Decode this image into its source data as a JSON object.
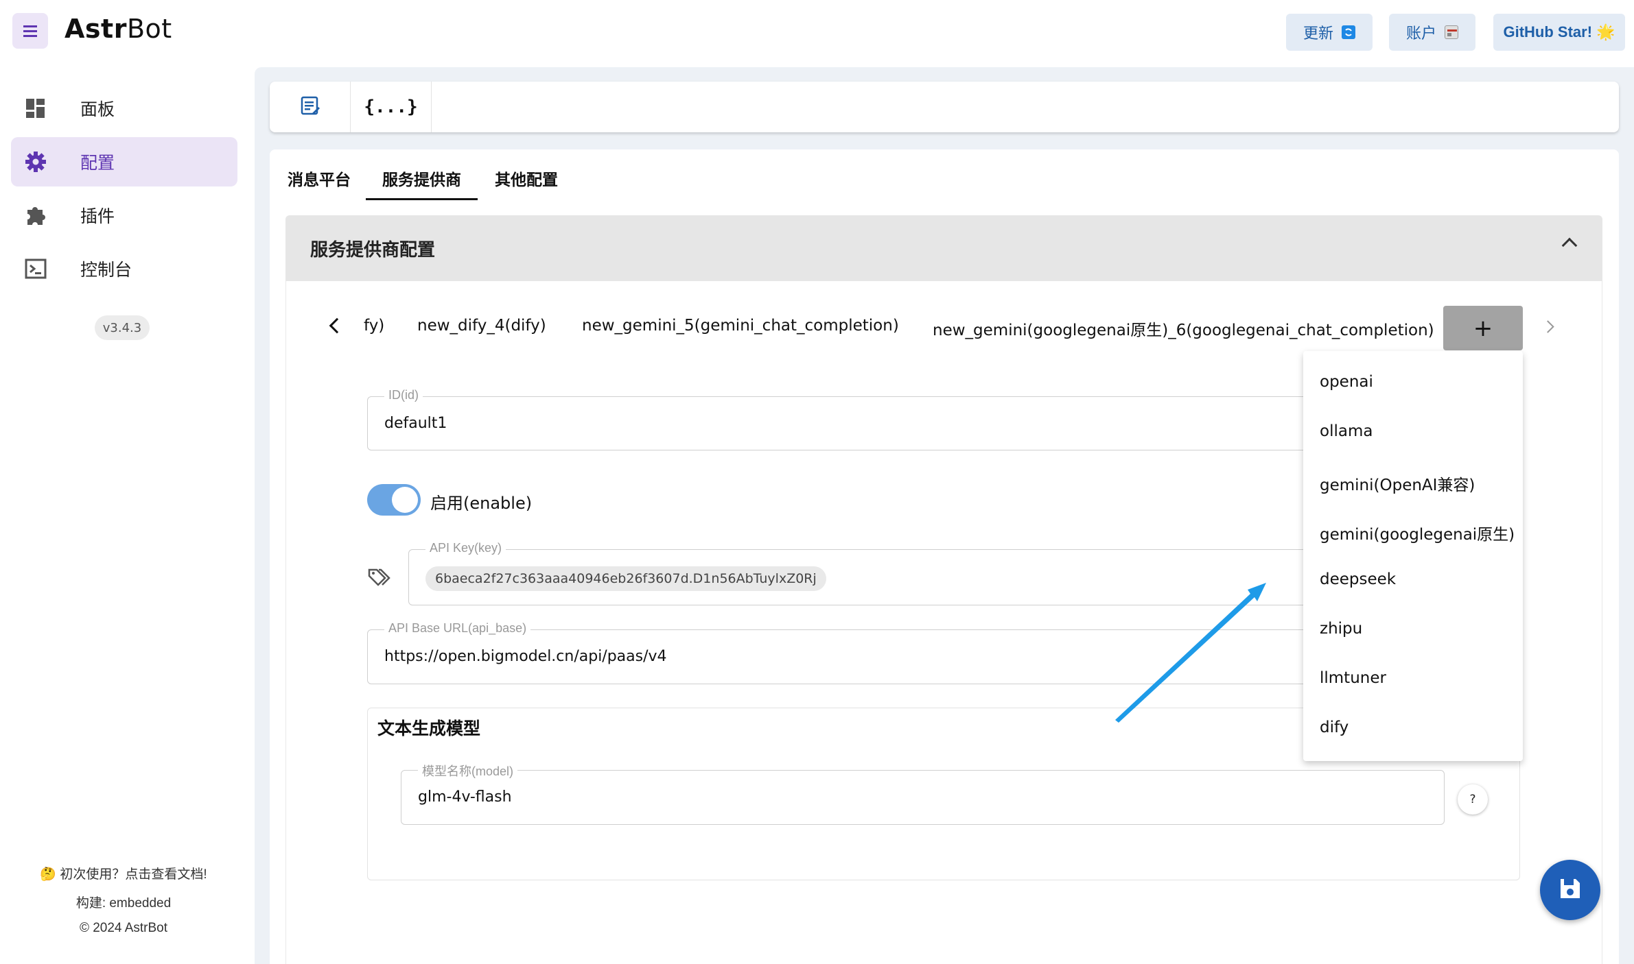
{
  "header": {
    "logo_bold": "Astr",
    "logo_rest": "Bot",
    "update_label": "更新",
    "account_label": "账户",
    "github_label": "GitHub Star! 🌟",
    "button_color": "#1e5fa8"
  },
  "sidebar": {
    "items": [
      {
        "label": "面板",
        "icon": "dashboard-icon"
      },
      {
        "label": "配置",
        "icon": "gear-icon",
        "active": true
      },
      {
        "label": "插件",
        "icon": "puzzle-icon"
      },
      {
        "label": "控制台",
        "icon": "terminal-icon"
      }
    ],
    "version": "v3.4.3",
    "docs_link": "🤔 初次使用？点击查看文档!",
    "build": "构建: embedded",
    "copyright": "© 2024 AstrBot",
    "accent": "#5e35b1"
  },
  "toolbar": {
    "visual_editor_icon": "edit-note-icon",
    "json_editor_label": "{...}"
  },
  "tabs": [
    {
      "label": "消息平台"
    },
    {
      "label": "服务提供商",
      "active": true
    },
    {
      "label": "其他配置"
    }
  ],
  "panel": {
    "title": "服务提供商配置"
  },
  "provider_tabs": [
    "fy)",
    "new_dify_4(dify)",
    "new_gemini_5(gemini_chat_completion)",
    "new_gemini(googlegenai原生)_6(googlegenai_chat_completion)"
  ],
  "add_button": "+",
  "form": {
    "id_label": "ID(id)",
    "id_value": "default1",
    "enable_label": "启用(enable)",
    "enabled": true,
    "api_key_label": "API Key(key)",
    "api_key_value": "6baeca2f27c363aaa40946eb26f3607d.D1n56AbTuylxZ0Rj",
    "api_base_label": "API Base URL(api_base)",
    "api_base_value": "https://open.bigmodel.cn/api/paas/v4",
    "model_section_title": "文本生成模型",
    "model_label": "模型名称(model)",
    "model_value": "glm-4v-flash",
    "help_label": "?"
  },
  "dropdown": {
    "items": [
      "openai",
      "ollama",
      "gemini(OpenAI兼容)",
      "gemini(googlegenai原生)",
      "deepseek",
      "zhipu",
      "llmtuner",
      "dify"
    ]
  },
  "save_fab_icon": "save-icon"
}
